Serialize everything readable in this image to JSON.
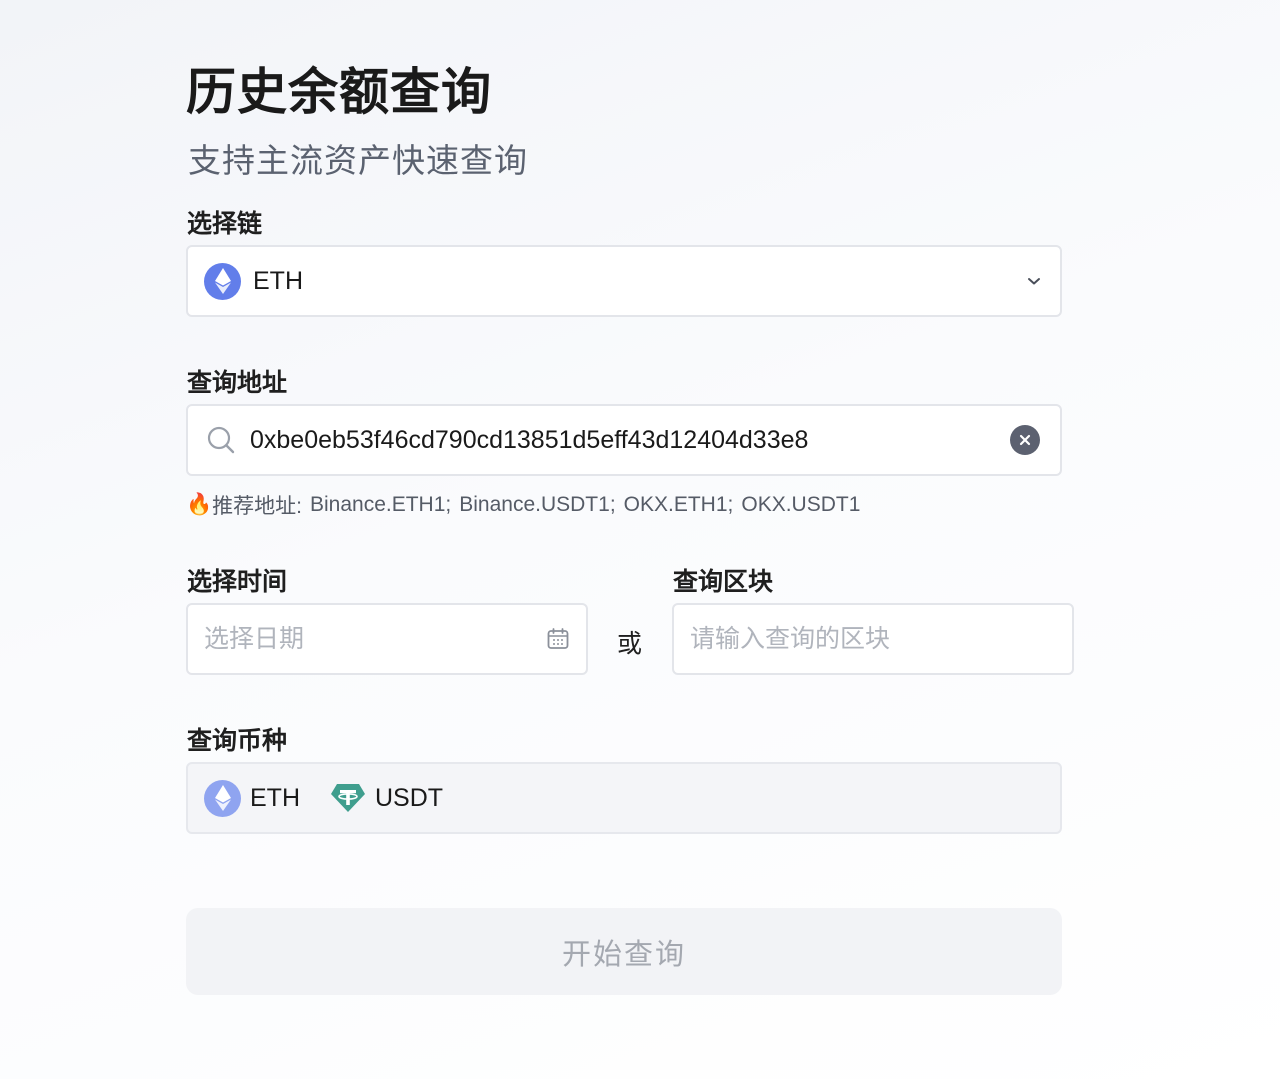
{
  "header": {
    "title": "历史余额查询",
    "subtitle": "支持主流资产快速查询"
  },
  "chain": {
    "label": "选择链",
    "selected": "ETH",
    "icon": "eth-icon"
  },
  "address": {
    "label": "查询地址",
    "value": "0xbe0eb53f46cd790cd13851d5eff43d12404d33e8",
    "hint_emoji": "🔥",
    "hint_prefix": "推荐地址:",
    "recommended": [
      "Binance.ETH1;",
      "Binance.USDT1;",
      "OKX.ETH1;",
      "OKX.USDT1"
    ]
  },
  "time": {
    "label": "选择时间",
    "placeholder": "选择日期"
  },
  "or_text": "或",
  "block": {
    "label": "查询区块",
    "placeholder": "请输入查询的区块"
  },
  "tokens": {
    "label": "查询币种",
    "items": [
      {
        "symbol": "ETH",
        "icon": "eth-icon",
        "color": "#8fa4f0"
      },
      {
        "symbol": "USDT",
        "icon": "tether-icon",
        "color": "#3f9e8e"
      }
    ]
  },
  "submit": {
    "label": "开始查询"
  },
  "colors": {
    "eth": "#627eea",
    "usdt": "#3f9e8e",
    "border": "#e3e5ea",
    "button_bg": "#f2f3f6",
    "button_text": "#a4a8b0"
  }
}
